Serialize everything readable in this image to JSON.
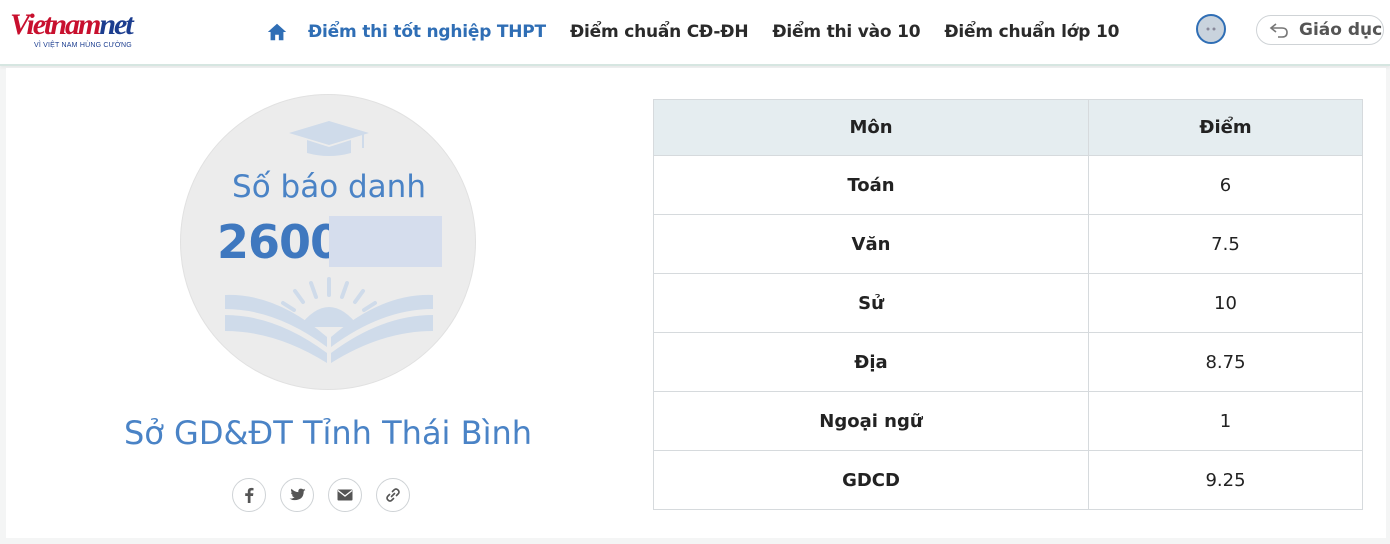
{
  "brand": {
    "logo_text": "vietnamnet",
    "logo_main": "Vietnam",
    "logo_accent": "net",
    "tagline": "VÌ VIỆT NAM HÙNG CƯỜNG"
  },
  "nav": {
    "home_icon": "home-icon",
    "items": [
      {
        "label": "Điểm thi tốt nghiệp THPT",
        "active": true
      },
      {
        "label": "Điểm chuẩn CĐ-ĐH",
        "active": false
      },
      {
        "label": "Điểm thi vào 10",
        "active": false
      },
      {
        "label": "Điểm chuẩn lớp 10",
        "active": false
      }
    ],
    "back_label": "Giáo dục"
  },
  "candidate": {
    "sbd_label": "Số báo danh",
    "sbd_value": "2600",
    "department": "Sở GD&ĐT Tỉnh Thái Bình"
  },
  "share": [
    "facebook-icon",
    "twitter-icon",
    "email-icon",
    "link-icon"
  ],
  "table": {
    "headers": {
      "subject": "Môn",
      "score": "Điểm"
    },
    "rows": [
      {
        "subject": "Toán",
        "score": "6"
      },
      {
        "subject": "Văn",
        "score": "7.5"
      },
      {
        "subject": "Sử",
        "score": "10"
      },
      {
        "subject": "Địa",
        "score": "8.75"
      },
      {
        "subject": "Ngoại ngữ",
        "score": "1"
      },
      {
        "subject": "GDCD",
        "score": "9.25"
      }
    ]
  },
  "colors": {
    "accent": "#2f6eb5",
    "brand_red": "#c8102e",
    "brand_blue": "#1b3d8f",
    "header_bg": "#e5edf0"
  }
}
